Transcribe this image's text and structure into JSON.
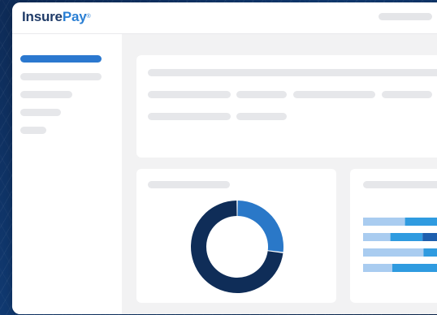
{
  "brand": {
    "name_part1": "Insure",
    "name_part2": "Pay",
    "trademark": "®",
    "colors": {
      "dark": "#1f3b68",
      "accent": "#2a7fd4"
    }
  },
  "sidebar": {
    "items": [
      {
        "state": "active"
      },
      {
        "state": "placeholder"
      },
      {
        "state": "placeholder"
      },
      {
        "state": "placeholder"
      },
      {
        "state": "placeholder"
      }
    ]
  },
  "colors": {
    "placeholder": "#e6e7ea",
    "sidebar_active": "#2b78cf",
    "donut_dark": "#0f2d58",
    "donut_light": "#2a78c8",
    "stack_light": "#a9ccf0",
    "stack_mid": "#2f9be0",
    "stack_dark": "#1e5fae"
  },
  "chart_data": [
    {
      "type": "pie",
      "variant": "donut",
      "values": [
        0.27,
        0.73
      ],
      "colors": [
        "#2a78c8",
        "#0f2d58"
      ]
    },
    {
      "type": "bar",
      "orientation": "horizontal",
      "stacked": true,
      "series": [
        {
          "values": [
            0.43,
            0.28,
            0.62,
            0.3
          ]
        },
        {
          "values": [
            0.57,
            0.33,
            0.38,
            0.7
          ]
        },
        {
          "values": [
            0,
            0.39,
            0,
            0
          ]
        }
      ],
      "colors": [
        "#a9ccf0",
        "#2f9be0",
        "#1e5fae"
      ]
    }
  ]
}
